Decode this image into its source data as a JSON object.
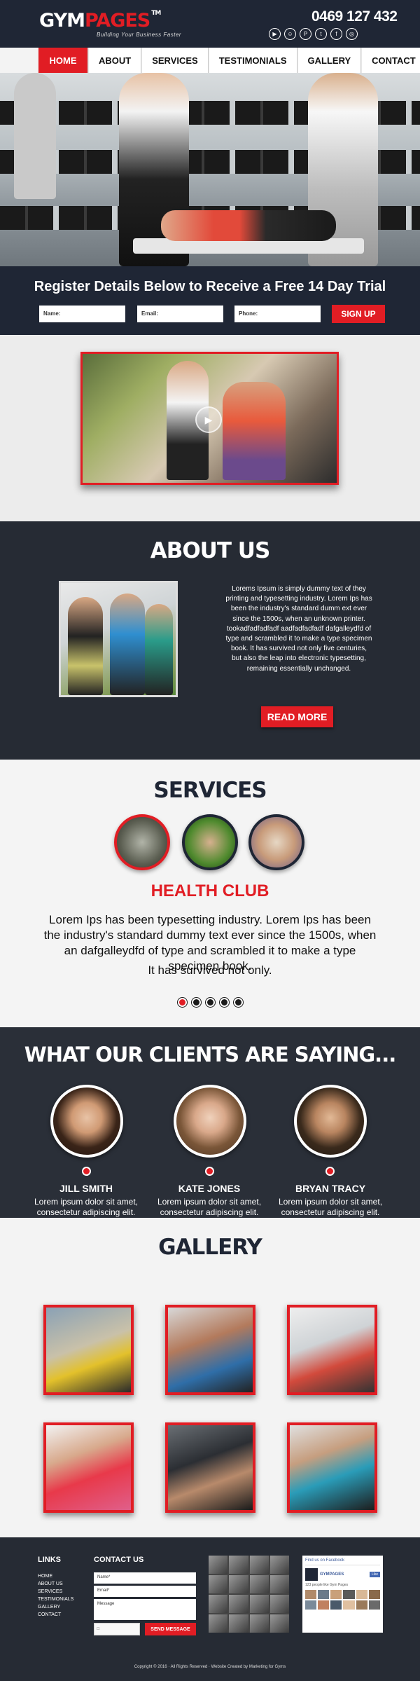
{
  "brand": {
    "logo_main": "GYM",
    "logo_accent": "PAGES",
    "logo_tm": "TM",
    "tagline": "Building Your Business Faster",
    "phone": "0469 127 432",
    "accent_color": "#e11d24",
    "dark_color": "#1f2635"
  },
  "social_icons": [
    "youtube-icon",
    "snapchat-icon",
    "pinterest-icon",
    "twitter-icon",
    "facebook-icon",
    "instagram-icon"
  ],
  "nav": {
    "items": [
      {
        "label": "HOME",
        "active": true
      },
      {
        "label": "ABOUT",
        "active": false
      },
      {
        "label": "SERVICES",
        "active": false
      },
      {
        "label": "TESTIMONIALS",
        "active": false
      },
      {
        "label": "GALLERY",
        "active": false
      },
      {
        "label": "CONTACT",
        "active": false
      }
    ]
  },
  "register": {
    "title": "Register Details Below to Receive a Free 14 Day Trial",
    "name_label": "Name:",
    "email_label": "Email:",
    "phone_label": "Phone:",
    "button": "SIGN UP"
  },
  "about": {
    "title": "ABOUT US",
    "text": "Lorems Ipsum is simply dummy text of they printing and typesetting industry. Lorem Ips has been the industry's standard dumm ext ever since the 1500s, when an unknown printer. tookadfadfadfadf aadfadfadfadf dafgalleydfd of type and scrambled it to make a type specimen book. It has survived not only five centuries, but also the leap into electronic typesetting, remaining essentially unchanged.",
    "button": "READ MORE"
  },
  "services": {
    "title": "SERVICES",
    "heading": "HEALTH CLUB",
    "text": "Lorem Ips has been typesetting industry. Lorem Ips has been the industry's standard dummy text ever since the 1500s, when an dafgalleydfd of type and scrambled it to make a type specimen book.",
    "text2": "It has survived not only.",
    "slider_active": 1,
    "slider_count": 5
  },
  "testimonials": {
    "title": "WHAT OUR CLIENTS ARE SAYING...",
    "items": [
      {
        "name": "JILL SMITH",
        "quote": "Lorem ipsum dolor sit amet, consectetur adipiscing elit. Aenean tincidunt sit amet"
      },
      {
        "name": "KATE JONES",
        "quote": "Lorem ipsum dolor sit amet, consectetur adipiscing elit. Aenean tincidunt sit amet"
      },
      {
        "name": "BRYAN TRACY",
        "quote": "Lorem ipsum dolor sit amet, consectetur adipiscing elit. Aenean tincidunt sit amet"
      }
    ]
  },
  "gallery": {
    "title": "GALLERY"
  },
  "footer": {
    "links_title": "LINKS",
    "links": [
      "HOME",
      "ABOUT US",
      "SERVICES",
      "TESTIMONIALS",
      "GALLERY",
      "CONTACT"
    ],
    "contact_title": "CONTACT US",
    "name_placeholder": "Name*",
    "email_placeholder": "Email*",
    "message_placeholder": "Message",
    "send_button": "SEND MESSAGE",
    "fb_title": "Find us on Facebook",
    "fb_page": "GYMPAGES",
    "fb_like": "Like",
    "fb_count": "123 people like Gym Pages",
    "copyright": "Copyright © 2016 · All Rights Reserved · Website Created by Marketing for Gyms"
  }
}
